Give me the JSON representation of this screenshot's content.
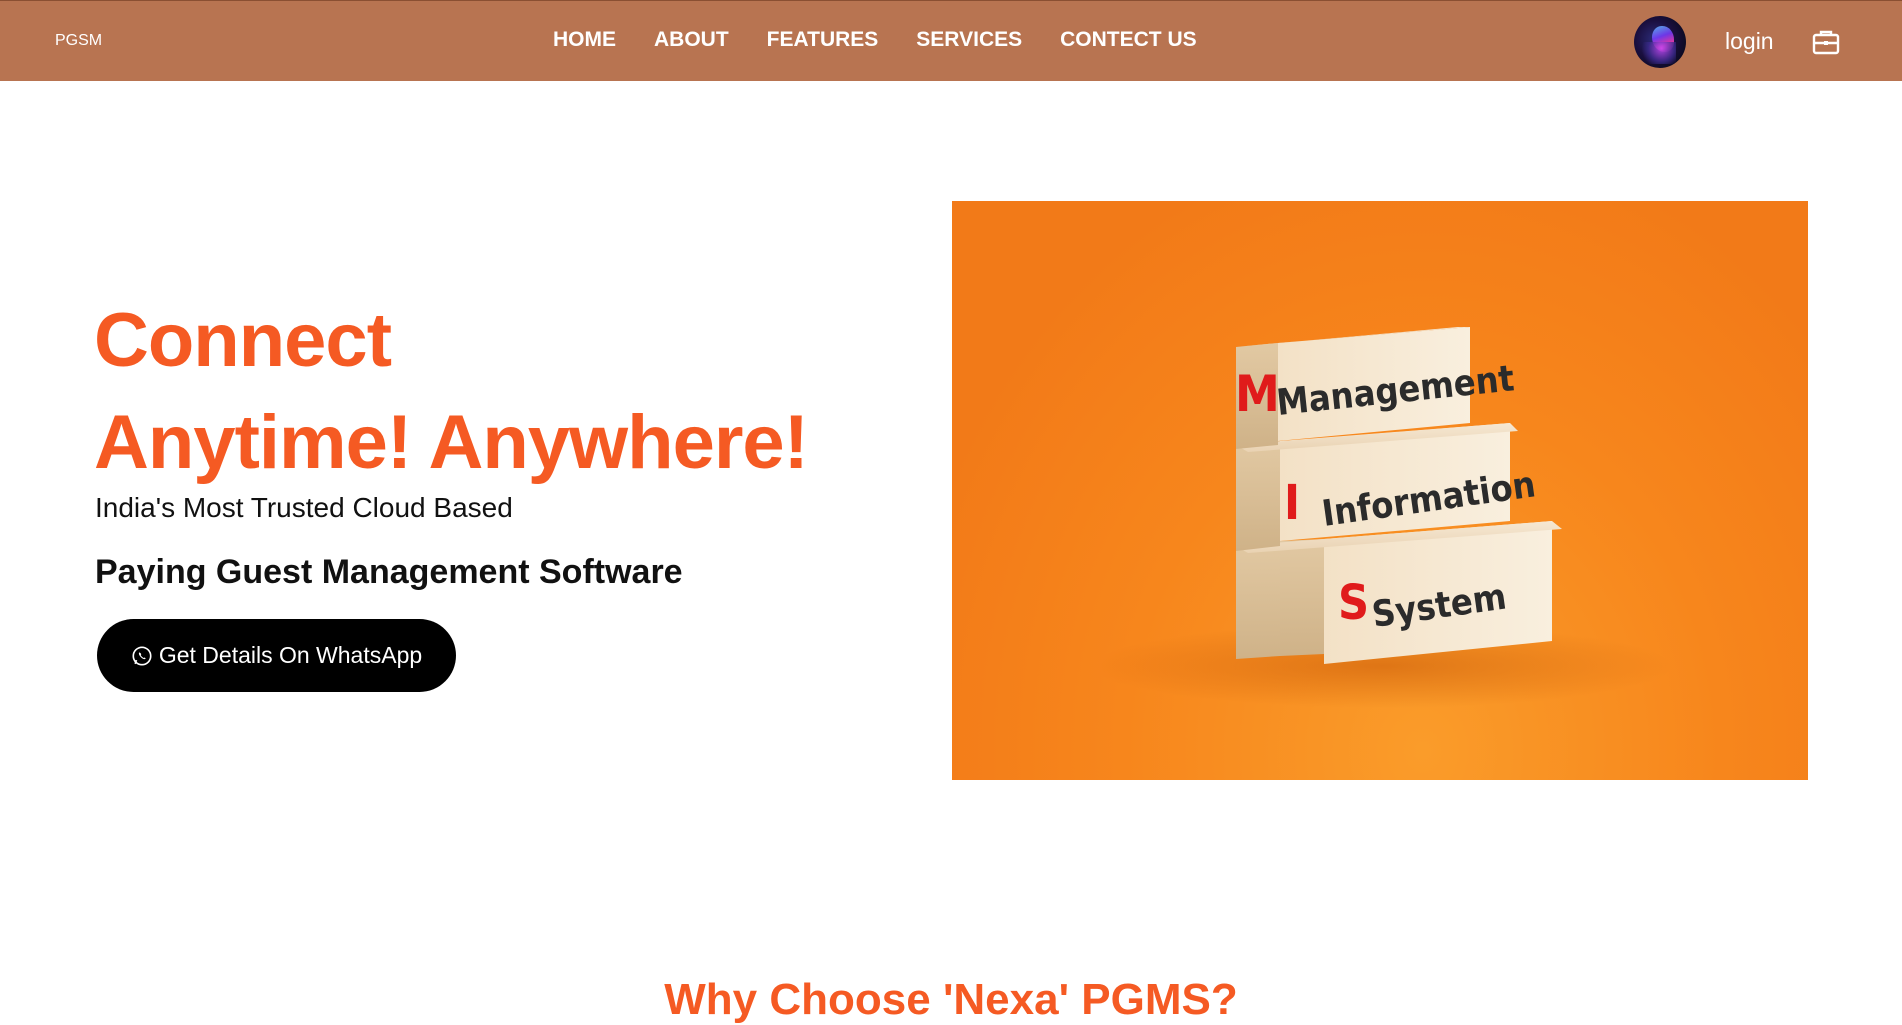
{
  "brand": "PGSM",
  "nav": {
    "links": [
      "HOME",
      "ABOUT",
      "FEATURES",
      "SERVICES",
      "CONTECT US"
    ],
    "login": "login",
    "avatar_icon": "user-avatar",
    "cart_icon": "briefcase-icon"
  },
  "hero": {
    "title_line1": "Connect",
    "title_line2": "Anytime! Anywhere!",
    "subtitle_line1": "India's Most Trusted Cloud Based",
    "subtitle_line2": "Paying Guest Management Software",
    "cta_label": "Get Details On WhatsApp",
    "cta_icon": "whatsapp-icon",
    "image": {
      "block_letters": [
        "M",
        "I",
        "S"
      ],
      "block_words": [
        "Management",
        "Information",
        "System"
      ]
    }
  },
  "next_section": {
    "heading": "Why Choose 'Nexa' PGMS?"
  },
  "colors": {
    "navbar": "#b87451",
    "accent": "#f55a23",
    "button": "#000000",
    "image_bg": "#f7861c"
  }
}
